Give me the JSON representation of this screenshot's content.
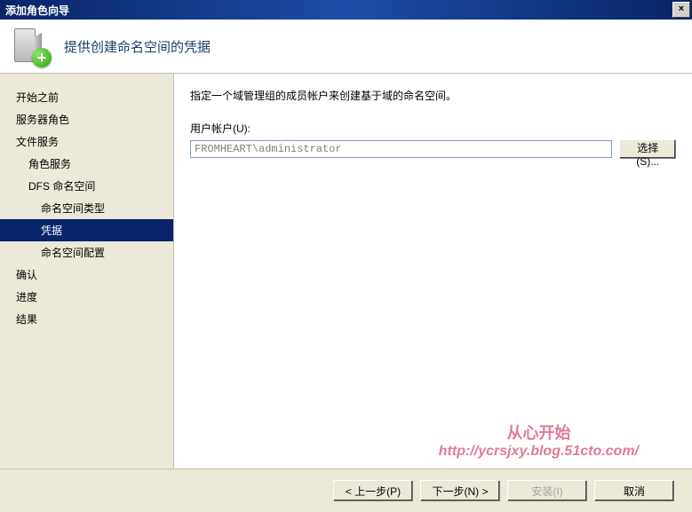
{
  "window": {
    "title": "添加角色向导",
    "close_glyph": "×"
  },
  "header": {
    "title": "提供创建命名空间的凭据",
    "plus_glyph": "+"
  },
  "sidebar": {
    "items": [
      {
        "label": "开始之前",
        "level": 1,
        "selected": false
      },
      {
        "label": "服务器角色",
        "level": 1,
        "selected": false
      },
      {
        "label": "文件服务",
        "level": 1,
        "selected": false
      },
      {
        "label": "角色服务",
        "level": 2,
        "selected": false
      },
      {
        "label": "DFS 命名空间",
        "level": 2,
        "selected": false
      },
      {
        "label": "命名空间类型",
        "level": 3,
        "selected": false
      },
      {
        "label": "凭据",
        "level": 3,
        "selected": true
      },
      {
        "label": "命名空间配置",
        "level": 3,
        "selected": false
      },
      {
        "label": "确认",
        "level": 1,
        "selected": false
      },
      {
        "label": "进度",
        "level": 1,
        "selected": false
      },
      {
        "label": "结果",
        "level": 1,
        "selected": false
      }
    ]
  },
  "content": {
    "description": "指定一个域管理组的成员帐户来创建基于域的命名空间。",
    "account_label": "用户帐户(U):",
    "account_value": "FROMHEART\\administrator",
    "select_button": "选择(S)..."
  },
  "footer": {
    "prev": "< 上一步(P)",
    "next": "下一步(N) >",
    "install": "安装(I)",
    "cancel": "取消"
  },
  "watermark": {
    "line1": "从心开始",
    "line2": "http://ycrsjxy.blog.51cto.com/"
  }
}
